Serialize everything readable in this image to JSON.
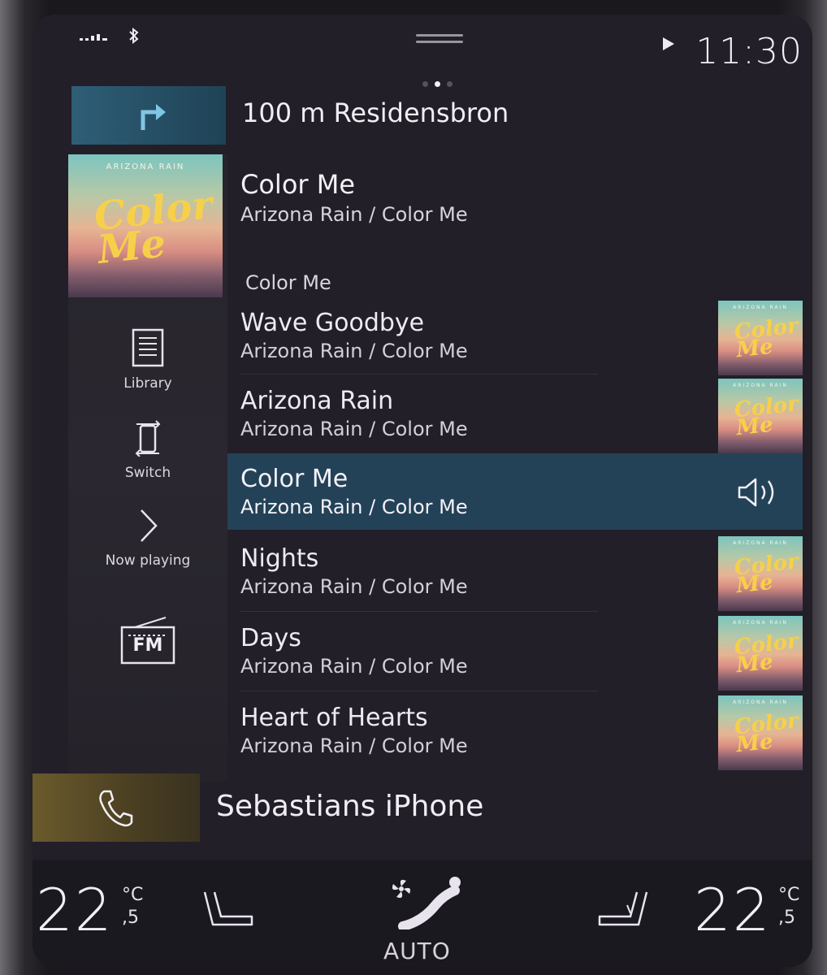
{
  "status": {
    "time": "11:30",
    "signal_icon": "signal-bars-icon",
    "bluetooth_icon": "bluetooth-icon"
  },
  "navigation": {
    "instruction": "100 m Residensbron",
    "icon": "turn-right-arrow-icon"
  },
  "now_playing": {
    "title": "Color Me",
    "subtitle": "Arizona Rain / Color Me",
    "album_label": "ARIZONA RAIN",
    "album_script": "Color Me"
  },
  "sidebar": {
    "items": [
      {
        "label": "Library",
        "icon": "library-list-icon"
      },
      {
        "label": "Switch",
        "icon": "switch-device-icon"
      },
      {
        "label": "Now playing",
        "icon": "chevron-right-icon"
      },
      {
        "label": "FM",
        "icon": "fm-radio-icon"
      }
    ]
  },
  "playlist": {
    "section": "Color Me",
    "tracks": [
      {
        "title": "Wave Goodbye",
        "subtitle": "Arizona Rain / Color Me"
      },
      {
        "title": "Arizona Rain",
        "subtitle": "Arizona Rain / Color Me"
      },
      {
        "title": "Color Me",
        "subtitle": "Arizona Rain / Color Me",
        "playing": true
      },
      {
        "title": "Nights",
        "subtitle": "Arizona Rain / Color Me"
      },
      {
        "title": "Days",
        "subtitle": "Arizona Rain / Color Me"
      },
      {
        "title": "Heart of Hearts",
        "subtitle": "Arizona Rain / Color Me"
      }
    ]
  },
  "phone": {
    "device": "Sebastians iPhone",
    "icon": "phone-handset-icon"
  },
  "climate": {
    "left_temp": "22",
    "left_unit": "°C",
    "left_decimal": ",5",
    "right_temp": "22",
    "right_unit": "°C",
    "right_decimal": ",5",
    "fan_mode": "AUTO"
  },
  "colors": {
    "accent_nav": "#2e5e76",
    "playing_row": "#234257",
    "phone_box": "#6b5a2c",
    "background": "#221f28"
  }
}
